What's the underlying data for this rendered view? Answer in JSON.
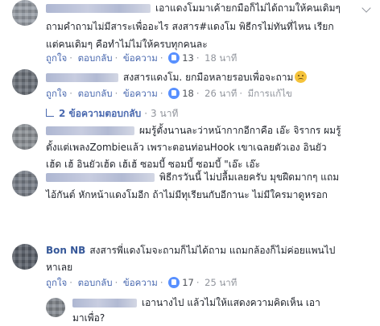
{
  "ui": {
    "like_label": "ถูกใจ",
    "reply_label": "ตอบกลับ",
    "message_label": "ข้อความ",
    "separator": "·",
    "not_edited_label": "มีการแก้ไข"
  },
  "comments": [
    {
      "lines": [
        "เอาแดงโมมาเค้ายกมือก็ไม่ได้ถามให้คนเดิมๆ",
        "ถามคำถามไม่มีสาระเพื่ออะไร สงสาร#แดงโม พิธีกรไม่ทันที่ไหน เรียก",
        "แต่คนเดิมๆ คือทำไม่ไม่ให้ครบทุกคนละ"
      ],
      "reactions": "13",
      "time": "18 นาที"
    },
    {
      "lines": [
        "สงสารแดงโม. ยกมือหลายรอบเพื่อจะถาม"
      ],
      "reactions": "18",
      "time": "26 นาที",
      "edited": "มีการแก้ไข",
      "replies_label": "2 ข้อความตอบกลับ",
      "replies_time": "3 นาที"
    },
    {
      "lines": [
        "ผมรู้ตั้งนานละว่าหน้ากากอีกาคือ เอ๊ะ จิรากร ผมรู้",
        "ตั้งแต่เพลงZombieแล้ว เพราะตอนท่อนHook เขาเฉลยตัวเอง อินยัว",
        "เฮ้ด เฮ้ อินยัวเฮ้ด เฮ้เฮ้ ซอมบี้ ซอมบี้ ซอมบี้ \"เอ๊ะ เอ๊ะ"
      ]
    },
    {
      "lines": [
        "พิธีกรวันนี้ ไม่ปลื้มเลยครับ มุขฝืดมากๆ แถม",
        "ไอ้กันต์ หักหน้าแดงโมอีก ถ้าไม่มีทุเรียนกับอีกานะ ไม่มีใครมาดูหรอก"
      ]
    },
    {
      "name": "Bon NB",
      "lines": [
        "สงสารพี่แดงโมจะถามก็ไม่ได้ถาม แถมกล้องก็ไม่ค่อยแพนไป",
        "หาเลย"
      ],
      "reactions": "17",
      "time": "25 นาที"
    },
    {
      "lines": [
        "เอานางไป แล้วไม่ให้แสดงความคิดเห็น เอา",
        "มาเพื่อ?"
      ]
    }
  ]
}
